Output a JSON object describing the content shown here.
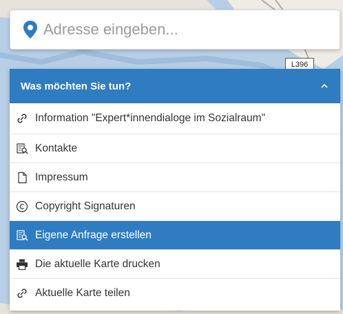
{
  "search": {
    "placeholder": "Adresse eingeben...",
    "icon": "map-pin-icon",
    "accent": "#2f7cc0"
  },
  "map": {
    "road_label": "L396"
  },
  "panel": {
    "title": "Was möchten Sie tun?",
    "header_color": "#2f7cc0",
    "items": [
      {
        "label": "Information \"Expert*innendialoge im Sozialraum\"",
        "icon": "link-icon"
      },
      {
        "label": "Kontakte",
        "icon": "search-document-icon"
      },
      {
        "label": "Impressum",
        "icon": "document-icon"
      },
      {
        "label": "Copyright Signaturen",
        "icon": "copyright-icon"
      },
      {
        "label": "Eigene Anfrage erstellen",
        "icon": "search-document-icon",
        "active": true
      },
      {
        "label": "Die aktuelle Karte drucken",
        "icon": "printer-icon"
      },
      {
        "label": "Aktuelle Karte teilen",
        "icon": "link-icon"
      }
    ]
  }
}
